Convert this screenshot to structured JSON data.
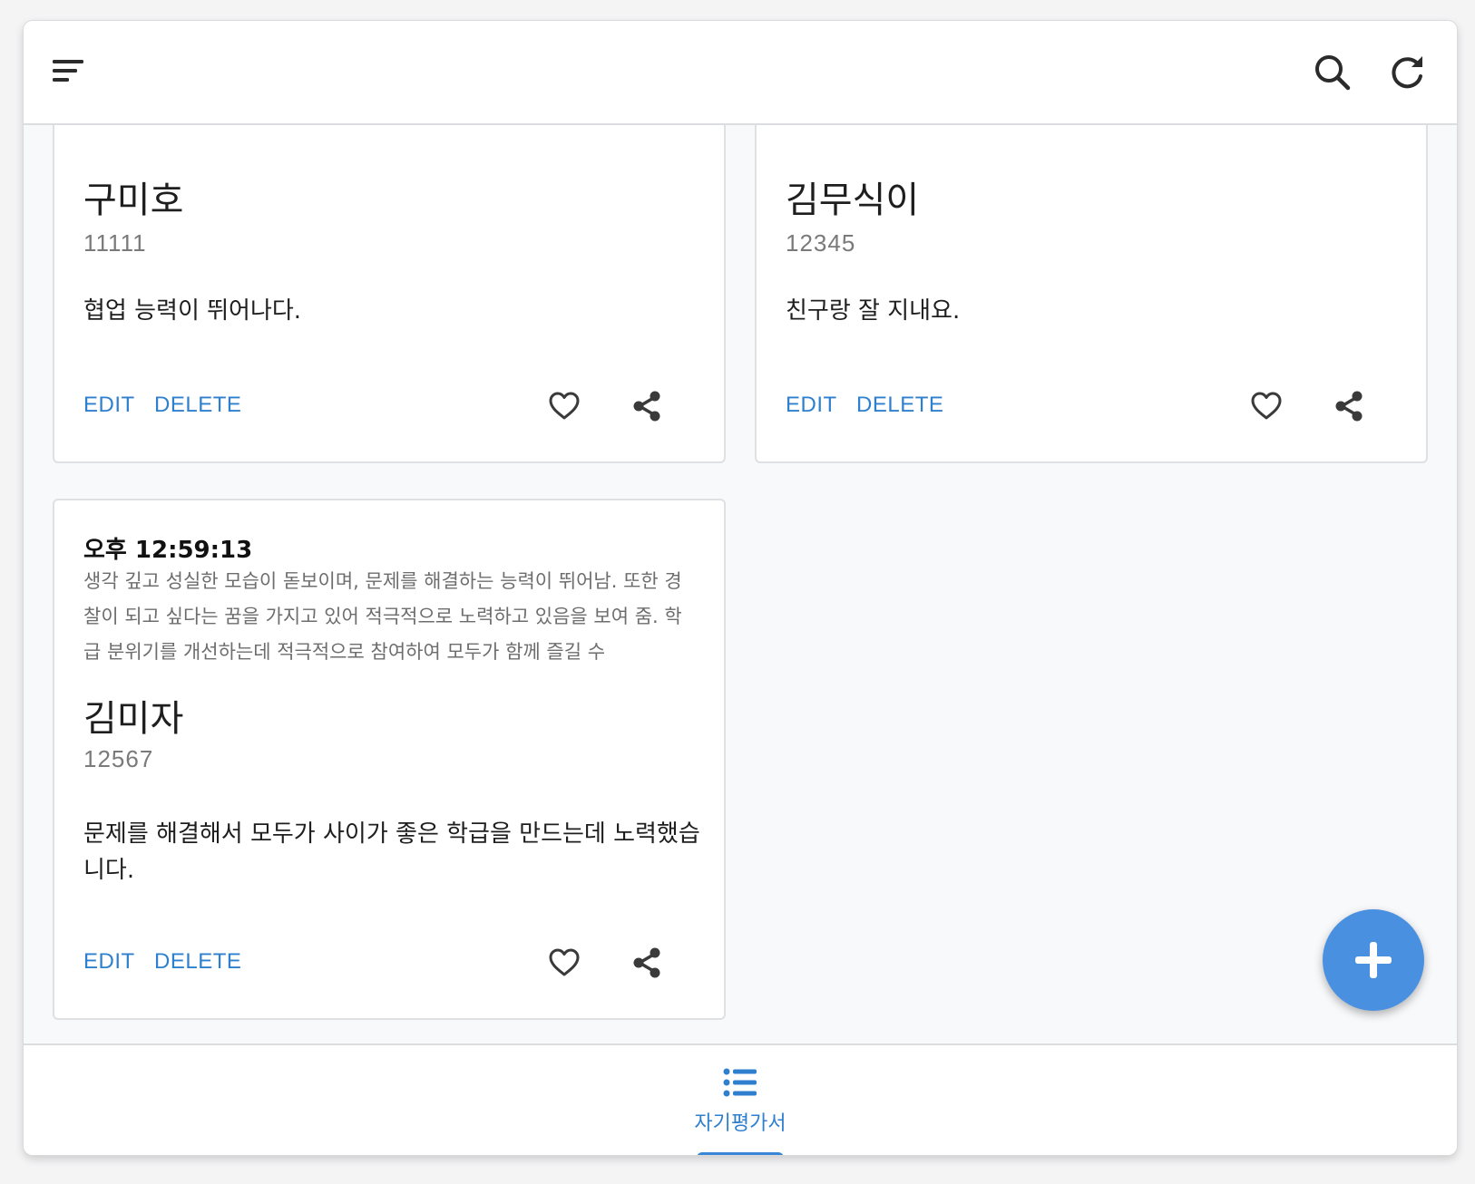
{
  "colors": {
    "accent": "#2f7fcf",
    "fab": "#4a90e0",
    "background": "#f8f9fb",
    "card": "#ffffff"
  },
  "topbar": {
    "menu_icon": "sort-menu-icon",
    "search_icon": "search-icon",
    "refresh_icon": "refresh-icon"
  },
  "cards": [
    {
      "name": "구미호",
      "number": "11111",
      "text": "협업 능력이 뛰어나다.",
      "edit_label": "EDIT",
      "delete_label": "DELETE"
    },
    {
      "name": "김무식이",
      "number": "12345",
      "text": "친구랑 잘 지내요.",
      "edit_label": "EDIT",
      "delete_label": "DELETE"
    },
    {
      "time": "오후 12:59:13",
      "summary": "생각 깊고 성실한 모습이 돋보이며, 문제를 해결하는 능력이 뛰어남. 또한 경찰이 되고 싶다는 꿈을 가지고 있어 적극적으로 노력하고 있음을 보여 줌. 학급 분위기를 개선하는데 적극적으로 참여하여 모두가 함께 즐길 수",
      "name": "김미자",
      "number": "12567",
      "text": "문제를 해결해서 모두가 사이가 좋은 학급을 만드는데 노력했습니다.",
      "edit_label": "EDIT",
      "delete_label": "DELETE"
    }
  ],
  "fab": {
    "icon": "plus-icon"
  },
  "bottom_nav": {
    "items": [
      {
        "label": "자기평가서",
        "icon": "list-icon",
        "active": true
      }
    ]
  }
}
